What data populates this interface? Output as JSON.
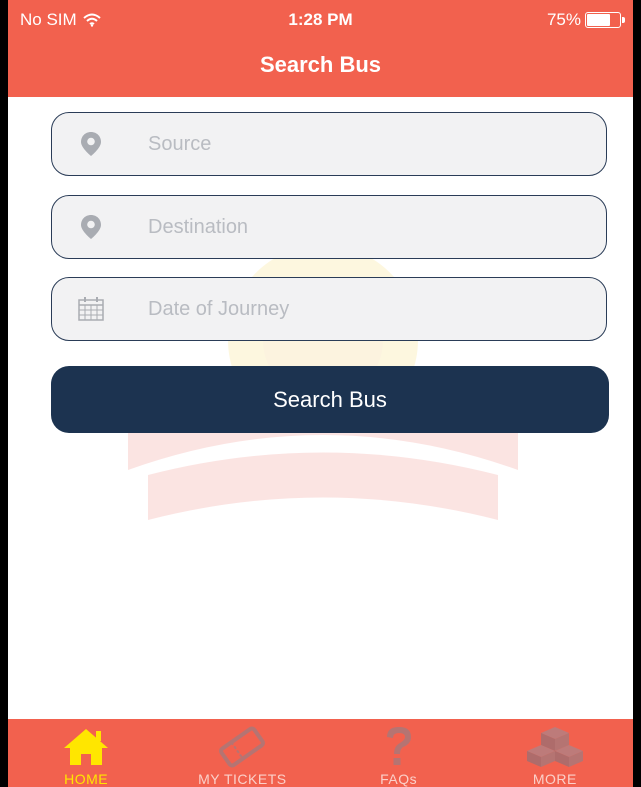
{
  "status_bar": {
    "carrier": "No SIM",
    "time": "1:28 PM",
    "battery": "75%",
    "battery_level": 0.75
  },
  "header": {
    "title": "Search Bus"
  },
  "form": {
    "source_placeholder": "Source",
    "destination_placeholder": "Destination",
    "date_placeholder": "Date of Journey",
    "search_label": "Search Bus"
  },
  "tabs": [
    {
      "label": "HOME",
      "icon": "home-icon",
      "active": true
    },
    {
      "label": "MY TICKETS",
      "icon": "ticket-icon",
      "active": false
    },
    {
      "label": "FAQs",
      "icon": "question-icon",
      "active": false
    },
    {
      "label": "MORE",
      "icon": "boxes-icon",
      "active": false
    }
  ],
  "colors": {
    "header": "#f2614e",
    "button": "#1c3350",
    "active_tab": "#ffe600"
  }
}
